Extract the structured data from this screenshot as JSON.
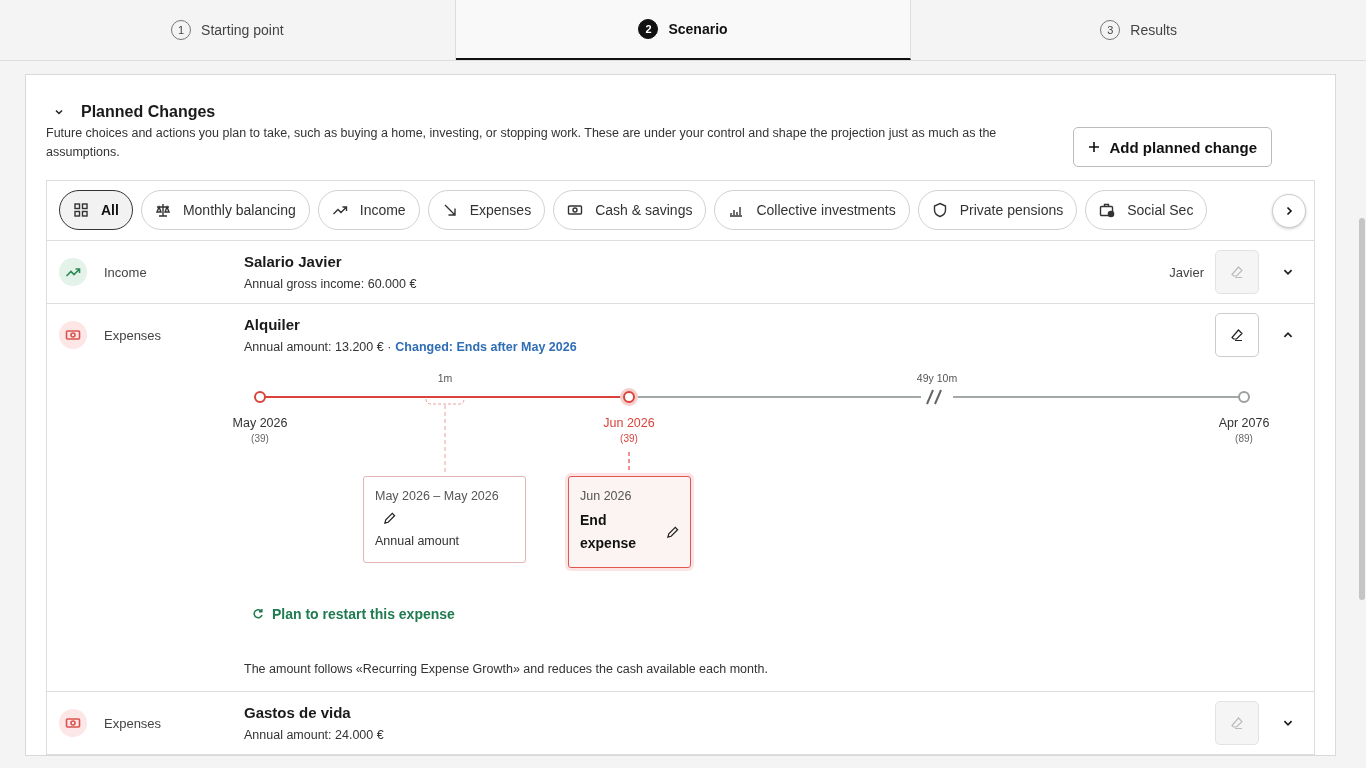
{
  "tabs": [
    {
      "number": "1",
      "label": "Starting point",
      "selected": false
    },
    {
      "number": "2",
      "label": "Scenario",
      "selected": true
    },
    {
      "number": "3",
      "label": "Results",
      "selected": false
    }
  ],
  "section": {
    "title": "Planned Changes",
    "expanded": true,
    "description": "Future choices and actions you plan to take, such as buying a home, investing, or stopping work. These are under your control and shape the projection just as much as the assumptions.",
    "add_button": "Add planned change"
  },
  "filters": [
    {
      "label": "All",
      "selected": true
    },
    {
      "label": "Monthly balancing",
      "selected": false
    },
    {
      "label": "Income",
      "selected": false
    },
    {
      "label": "Expenses",
      "selected": false
    },
    {
      "label": "Cash & savings",
      "selected": false
    },
    {
      "label": "Collective investments",
      "selected": false
    },
    {
      "label": "Private pensions",
      "selected": false
    },
    {
      "label": "Social Sec",
      "selected": false
    }
  ],
  "rows": [
    {
      "kind": "income",
      "category": "Income",
      "title": "Salario Javier",
      "subtitle": "Annual gross income: 60.000 €",
      "owner": "Javier",
      "erase_enabled": false,
      "expanded": false
    },
    {
      "kind": "expenses",
      "category": "Expenses",
      "title": "Alquiler",
      "subtitle": "Annual amount: 13.200 € ·",
      "change_note": "Changed: Ends after May 2026",
      "erase_enabled": true,
      "expanded": true,
      "timeline": {
        "points": [
          {
            "date": "May 2026",
            "age": "(39)",
            "active": false
          },
          {
            "date": "Jun 2026",
            "age": "(39)",
            "active": true
          },
          {
            "date": "Apr 2076",
            "age": "(89)",
            "active": false
          }
        ],
        "spans": [
          "1m",
          "49y 10m"
        ],
        "cards": [
          {
            "period": "May 2026 – May 2026",
            "title": "Annual amount",
            "selected": false
          },
          {
            "period": "Jun 2026",
            "title": "End expense",
            "selected": true
          }
        ],
        "restart_link": "Plan to restart this expense",
        "note": "The amount follows «Recurring Expense Growth» and reduces the cash available each month."
      }
    },
    {
      "kind": "expenses",
      "category": "Expenses",
      "title": "Gastos de vida",
      "subtitle": "Annual amount: 24.000 €",
      "erase_enabled": false,
      "expanded": false
    }
  ]
}
